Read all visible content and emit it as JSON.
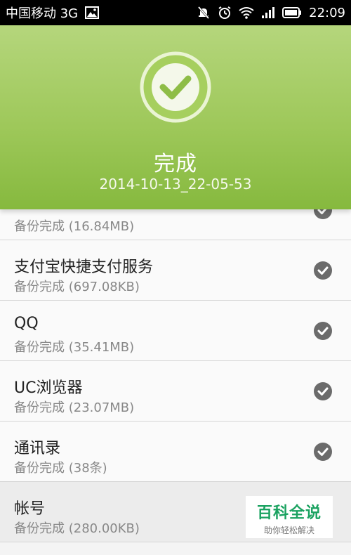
{
  "status_bar": {
    "carrier": "中国移动 3G",
    "time": "22:09",
    "icons": [
      "image-icon",
      "mute-icon",
      "alarm-icon",
      "wifi-icon",
      "signal-icon",
      "battery-icon"
    ]
  },
  "header": {
    "title": "完成",
    "subtitle": "2014-10-13_22-05-53",
    "icon": "check-circle-icon",
    "colors": {
      "top": "#b5d67c",
      "bottom": "#86b93e"
    }
  },
  "items": [
    {
      "title": "",
      "status": "备份完成 (16.84MB)"
    },
    {
      "title": "支付宝快捷支付服务",
      "status": "备份完成 (697.08KB)"
    },
    {
      "title": "QQ",
      "status": "备份完成 (35.41MB)"
    },
    {
      "title": "UC浏览器",
      "status": "备份完成 (23.07MB)"
    },
    {
      "title": "通讯录",
      "status": "备份完成 (38条)"
    },
    {
      "title": "帐号",
      "status": "备份完成 (280.00KB)"
    }
  ],
  "watermark": {
    "main": "百科全说",
    "sub": "助你轻松解决"
  }
}
